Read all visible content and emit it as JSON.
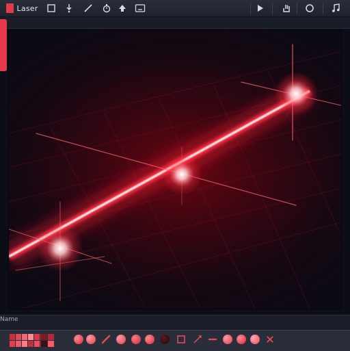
{
  "app": {
    "title": "Laser"
  },
  "toolbar": {
    "icons": [
      "grid-icon",
      "color-drop-icon",
      "pencil-icon",
      "timer-icon",
      "up-arrow-icon",
      "export-icon",
      "play-icon",
      "hand-icon",
      "circle-icon",
      "music-note-icon"
    ]
  },
  "status": {
    "label": "Name"
  },
  "colors": {
    "accent": "#e63a4c",
    "beam": "#ff3344",
    "toolbar": "#262a36"
  },
  "palette": {
    "swatches": [
      "#c8303e",
      "#e0485a",
      "#f26a78",
      "#ff8a95",
      "#d23a4a",
      "#a82834",
      "#e04050",
      "#f05868",
      "#ff7a86",
      "#c0303e",
      "#e85060",
      "#b02a38"
    ],
    "swatches2": [
      "#7a1a24",
      "#b02a38",
      "#3a1018",
      "#ff5a6a"
    ]
  }
}
